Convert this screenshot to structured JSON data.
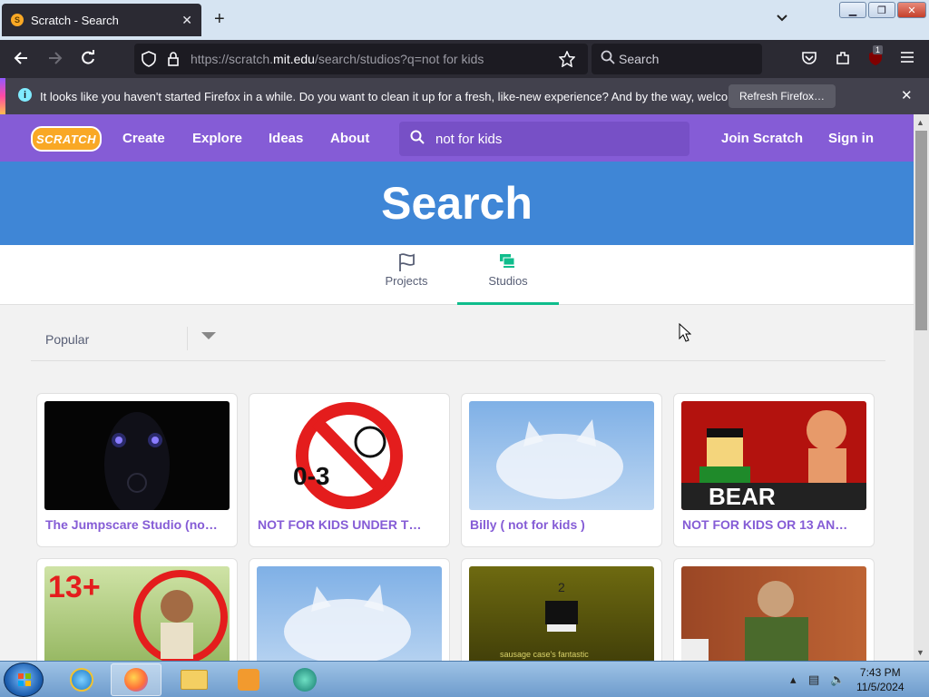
{
  "browser": {
    "tab_title": "Scratch - Search",
    "tab_favicon_text": "S",
    "new_tab": "+",
    "url_prefix": "https://scratch.",
    "url_domain": "mit.edu",
    "url_suffix": "/search/studios?q=not for kids",
    "search_placeholder": "Search",
    "extension_badge": "1"
  },
  "notification": {
    "message": "It looks like you haven't started Firefox in a while. Do you want to clean it up for a fresh, like-new experience? And by the way, welcome back!",
    "button": "Refresh Firefox…"
  },
  "scratch": {
    "logo": "SCRATCH",
    "nav": [
      "Create",
      "Explore",
      "Ideas",
      "About"
    ],
    "search_value": "not for kids",
    "join": "Join Scratch",
    "signin": "Sign in",
    "banner": "Search",
    "tabs": [
      {
        "label": "Projects",
        "icon": "flag-icon",
        "active": false
      },
      {
        "label": "Studios",
        "icon": "studios-icon",
        "active": true
      }
    ],
    "sort": "Popular",
    "cards": [
      {
        "title": "The Jumpscare Studio (no…",
        "thumb": "jumpscare"
      },
      {
        "title": "NOT FOR KIDS UNDER T…",
        "thumb": "nosign"
      },
      {
        "title": "Billy ( not for kids )",
        "thumb": "cloudcat"
      },
      {
        "title": "NOT FOR KIDS OR 13 AN…",
        "thumb": "bear"
      },
      {
        "title": "",
        "thumb": "thirteen"
      },
      {
        "title": "",
        "thumb": "cloudcat"
      },
      {
        "title": "",
        "thumb": "dark-olive"
      },
      {
        "title": "",
        "thumb": "figure"
      }
    ],
    "thumb_texts": {
      "nosign": "0-3",
      "bear": "BEAR",
      "thirteen": "13+",
      "dark_olive_num": "2",
      "dark_olive_caption": "sausage case's fantastic"
    }
  },
  "taskbar": {
    "time": "7:43 PM",
    "date": "11/5/2024"
  },
  "colors": {
    "scratch_purple": "#855cd6",
    "banner_blue": "#3f86d6",
    "studios_green": "#0fbd8c"
  }
}
